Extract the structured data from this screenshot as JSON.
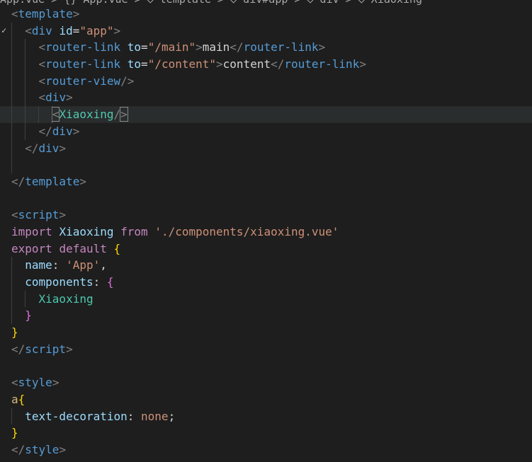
{
  "breadcrumb": "App.vue > {} App.vue > ◇ template > ◇ div#app > ◇ div > ◇ Xiaoxing",
  "tokens": {
    "template": "template",
    "div": "div",
    "id": "id",
    "app_val": "\"app\"",
    "router_link": "router-link",
    "to": "to",
    "main_path": "\"/main\"",
    "main_text": "main",
    "content_path": "\"/content\"",
    "content_text": "content",
    "router_view": "router-view",
    "xiaoxing": "Xiaoxing",
    "script": "script",
    "import": "import",
    "from": "from",
    "import_path": "'./components/xiaoxing.vue'",
    "export": "export",
    "default": "default",
    "name_key": "name",
    "name_val": "'App'",
    "components_key": "components",
    "style": "style",
    "selector": "a",
    "prop": "text-decoration",
    "prop_val": "none"
  }
}
